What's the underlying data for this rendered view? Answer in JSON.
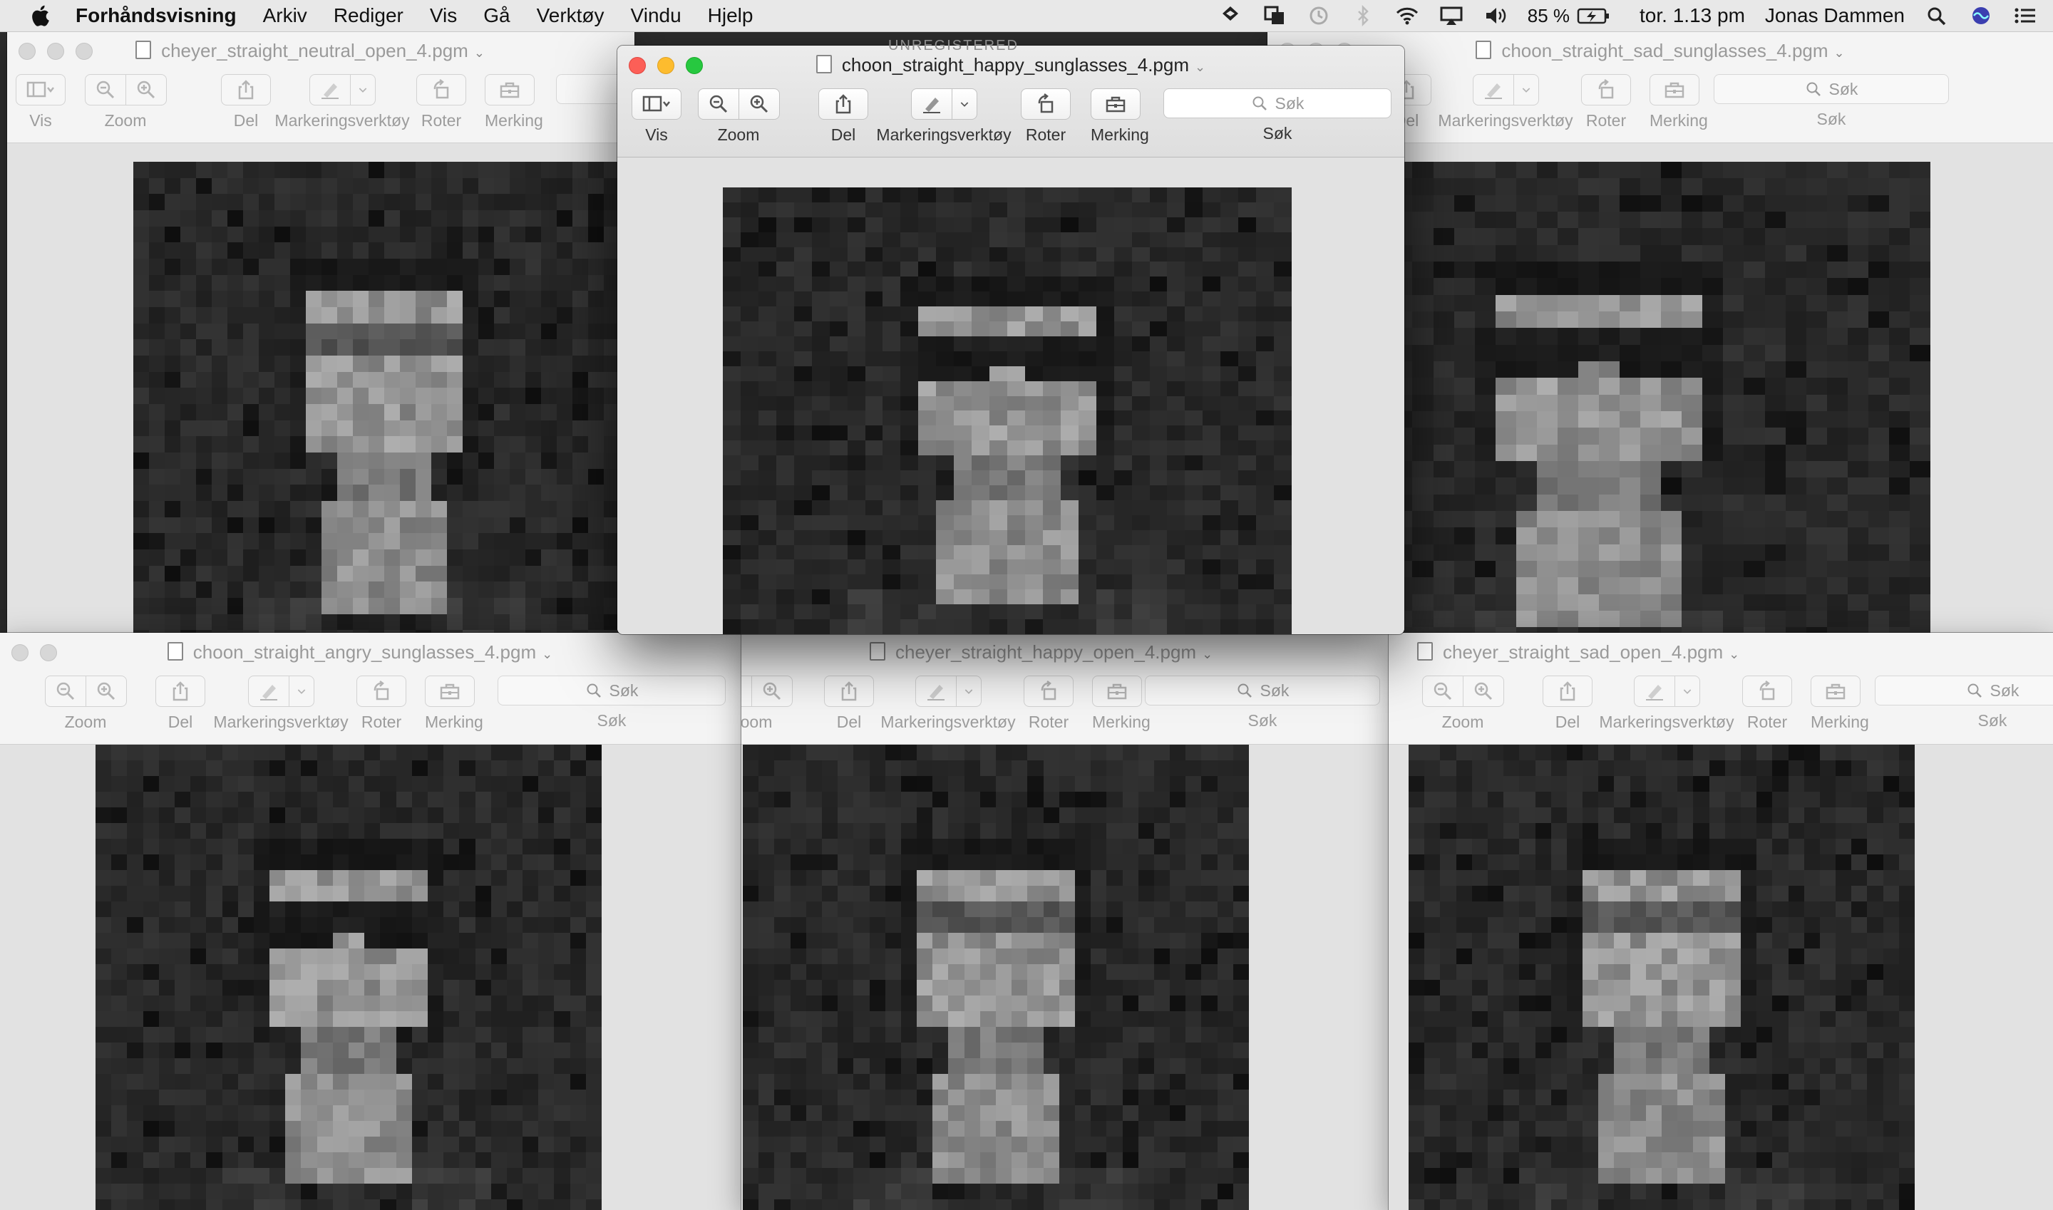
{
  "menubar": {
    "app_name": "Forhåndsvisning",
    "items": [
      "Arkiv",
      "Rediger",
      "Vis",
      "Gå",
      "Verktøy",
      "Vindu",
      "Hjelp"
    ],
    "battery": "85 %",
    "clock": "tor. 1.13 pm",
    "user": "Jonas Dammen"
  },
  "toolbar": {
    "vis": "Vis",
    "zoom": "Zoom",
    "del": "Del",
    "markeringsverktoy": "Markeringsverktøy",
    "roter": "Roter",
    "merking": "Merking",
    "sok": "Søk",
    "search_placeholder": "Søk"
  },
  "windows": [
    {
      "title": "cheyer_straight_neutral_open_4.pgm",
      "active": false
    },
    {
      "title": "choon_straight_happy_sunglasses_4.pgm",
      "active": true
    },
    {
      "title": "choon_straight_sad_sunglasses_4.pgm",
      "active": false
    },
    {
      "title": "choon_straight_angry_sunglasses_4.pgm",
      "active": false
    },
    {
      "title": "cheyer_straight_happy_open_4.pgm",
      "active": false
    },
    {
      "title": "cheyer_straight_sad_open_4.pgm",
      "active": false
    }
  ],
  "watermark": "UNREGISTERED",
  "colors": {
    "menubar_bg": "#e8e8e8",
    "close": "#fc5f57",
    "minimize": "#fdbc2e",
    "maximize": "#27c840"
  }
}
